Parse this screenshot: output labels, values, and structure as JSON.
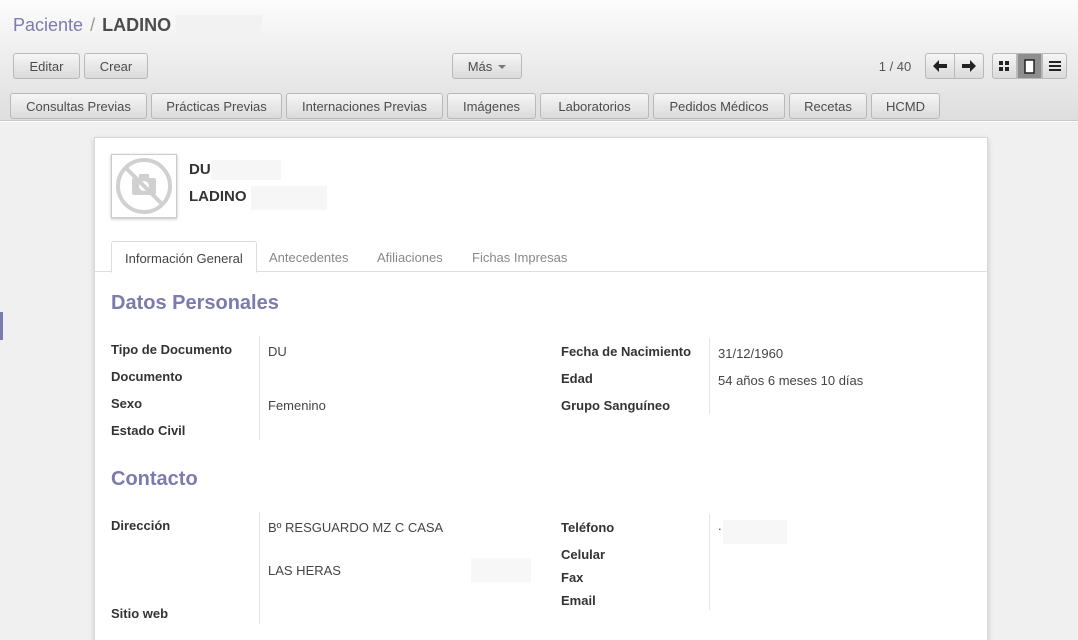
{
  "breadcrumb": {
    "parent": "Paciente",
    "separator": "/",
    "current": "LADINO"
  },
  "toolbar": {
    "edit_label": "Editar",
    "create_label": "Crear",
    "more_label": "Más"
  },
  "pager": {
    "value": "1 / 40"
  },
  "smart_tabs": [
    "Consultas Previas",
    "Prácticas Previas",
    "Internaciones Previas",
    "Imágenes",
    "Laboratorios",
    "Pedidos Médicos",
    "Recetas",
    "HCMD"
  ],
  "record": {
    "name_line1": "DU",
    "name_line2": "LADINO"
  },
  "notebook_tabs": [
    "Información General",
    "Antecedentes",
    "Afiliaciones",
    "Fichas Impresas"
  ],
  "datos_personales": {
    "title": "Datos Personales",
    "tipo_documento_label": "Tipo de Documento",
    "tipo_documento_value": "DU",
    "documento_label": "Documento",
    "sexo_label": "Sexo",
    "sexo_value": "Femenino",
    "estado_civil_label": "Estado Civil",
    "fecha_nacimiento_label": "Fecha de Nacimiento",
    "fecha_nacimiento_value": "31/12/1960",
    "edad_label": "Edad",
    "edad_value": "54 años 6 meses 10 días",
    "grupo_sanguineo_label": "Grupo Sanguíneo"
  },
  "contacto": {
    "title": "Contacto",
    "direccion_label": "Dirección",
    "direccion_line1": "Bº RESGUARDO MZ C CASA",
    "direccion_line2": "LAS HERAS",
    "sitio_web_label": "Sitio web",
    "telefono_label": "Teléfono",
    "telefono_value": ".",
    "celular_label": "Celular",
    "fax_label": "Fax",
    "email_label": "Email"
  }
}
